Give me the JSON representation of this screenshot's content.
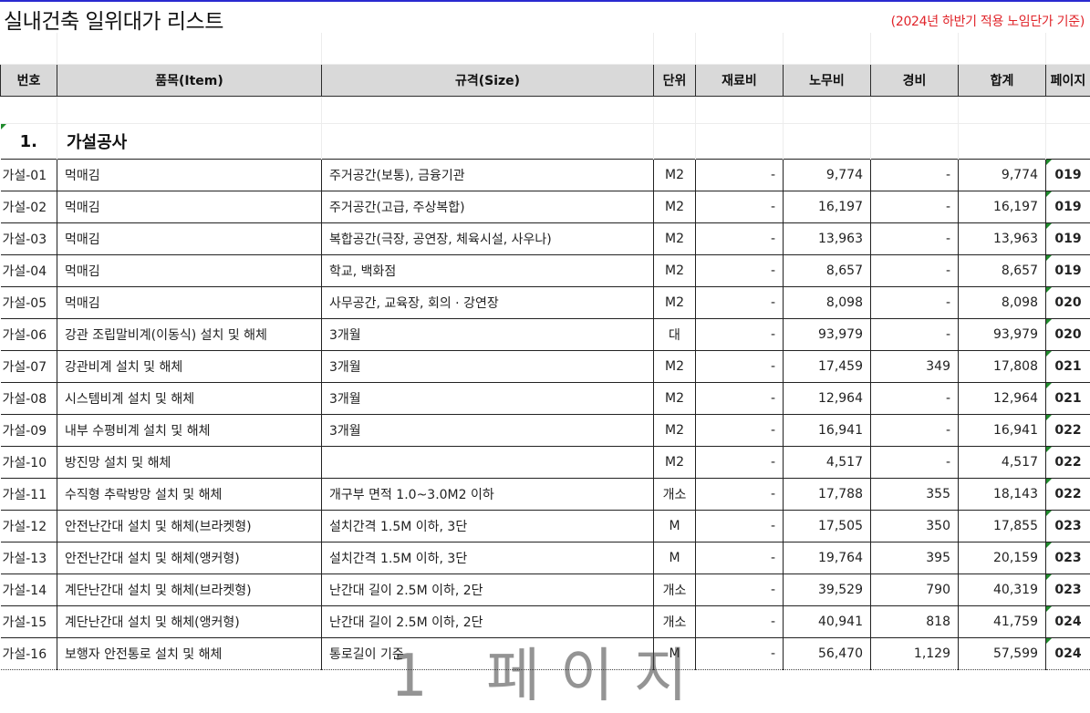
{
  "title": "실내건축 일위대가 리스트",
  "note": "(2024년 하반기 적용 노임단가 기준)",
  "colors": {
    "header_bg": "#d9d9d9",
    "note_red": "#e0242a",
    "marker_green": "#1f8a2c"
  },
  "headers": {
    "no": "번호",
    "item": "품목(Item)",
    "size": "규격(Size)",
    "unit": "단위",
    "material": "재료비",
    "labor": "노무비",
    "expense": "경비",
    "total": "합계",
    "page": "페이지"
  },
  "section": {
    "number": "1.",
    "title": "가설공사"
  },
  "rows": [
    {
      "no": "가설-01",
      "item": "먹매김",
      "size": "주거공간(보통), 금융기관",
      "unit": "M2",
      "material": "-",
      "labor": "9,774",
      "expense": "-",
      "total": "9,774",
      "page": "019"
    },
    {
      "no": "가설-02",
      "item": "먹매김",
      "size": "주거공간(고급, 주상복합)",
      "unit": "M2",
      "material": "-",
      "labor": "16,197",
      "expense": "-",
      "total": "16,197",
      "page": "019"
    },
    {
      "no": "가설-03",
      "item": "먹매김",
      "size": "복합공간(극장, 공연장, 체육시설, 사우나)",
      "unit": "M2",
      "material": "-",
      "labor": "13,963",
      "expense": "-",
      "total": "13,963",
      "page": "019"
    },
    {
      "no": "가설-04",
      "item": "먹매김",
      "size": "학교, 백화점",
      "unit": "M2",
      "material": "-",
      "labor": "8,657",
      "expense": "-",
      "total": "8,657",
      "page": "019"
    },
    {
      "no": "가설-05",
      "item": "먹매김",
      "size": "사무공간, 교육장, 회의 · 강연장",
      "unit": "M2",
      "material": "-",
      "labor": "8,098",
      "expense": "-",
      "total": "8,098",
      "page": "020"
    },
    {
      "no": "가설-06",
      "item": "강관 조립말비계(이동식) 설치 및 해체",
      "size": "3개월",
      "unit": "대",
      "material": "-",
      "labor": "93,979",
      "expense": "-",
      "total": "93,979",
      "page": "020"
    },
    {
      "no": "가설-07",
      "item": "강관비계 설치 및 해체",
      "size": "3개월",
      "unit": "M2",
      "material": "-",
      "labor": "17,459",
      "expense": "349",
      "total": "17,808",
      "page": "021"
    },
    {
      "no": "가설-08",
      "item": "시스템비계 설치 및 해체",
      "size": "3개월",
      "unit": "M2",
      "material": "-",
      "labor": "12,964",
      "expense": "-",
      "total": "12,964",
      "page": "021"
    },
    {
      "no": "가설-09",
      "item": "내부 수평비계 설치 및 해체",
      "size": "3개월",
      "unit": "M2",
      "material": "-",
      "labor": "16,941",
      "expense": "-",
      "total": "16,941",
      "page": "022"
    },
    {
      "no": "가설-10",
      "item": "방진망 설치 및 해체",
      "size": "",
      "unit": "M2",
      "material": "-",
      "labor": "4,517",
      "expense": "-",
      "total": "4,517",
      "page": "022"
    },
    {
      "no": "가설-11",
      "item": "수직형 추락방망 설치 및 해체",
      "size": "개구부 면적 1.0~3.0M2 이하",
      "unit": "개소",
      "material": "-",
      "labor": "17,788",
      "expense": "355",
      "total": "18,143",
      "page": "022"
    },
    {
      "no": "가설-12",
      "item": "안전난간대 설치 및 해체(브라켓형)",
      "size": "설치간격 1.5M 이하, 3단",
      "unit": "M",
      "material": "-",
      "labor": "17,505",
      "expense": "350",
      "total": "17,855",
      "page": "023"
    },
    {
      "no": "가설-13",
      "item": "안전난간대 설치 및 해체(앵커형)",
      "size": "설치간격 1.5M 이하, 3단",
      "unit": "M",
      "material": "-",
      "labor": "19,764",
      "expense": "395",
      "total": "20,159",
      "page": "023"
    },
    {
      "no": "가설-14",
      "item": "계단난간대 설치 및 해체(브라켓형)",
      "size": "난간대 길이 2.5M 이하, 2단",
      "unit": "개소",
      "material": "-",
      "labor": "39,529",
      "expense": "790",
      "total": "40,319",
      "page": "023"
    },
    {
      "no": "가설-15",
      "item": "계단난간대 설치 및 해체(앵커형)",
      "size": "난간대 길이 2.5M 이하, 2단",
      "unit": "개소",
      "material": "-",
      "labor": "40,941",
      "expense": "818",
      "total": "41,759",
      "page": "024"
    },
    {
      "no": "가설-16",
      "item": "보행자 안전통로 설치 및 해체",
      "size": "통로길이 기준",
      "unit": "M",
      "material": "-",
      "labor": "56,470",
      "expense": "1,129",
      "total": "57,599",
      "page": "024"
    }
  ],
  "watermark": "1 페이지"
}
